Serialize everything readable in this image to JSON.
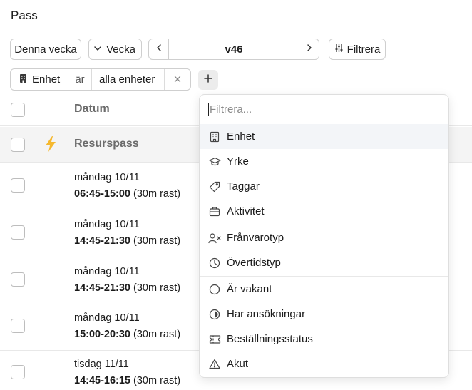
{
  "page": {
    "title": "Pass"
  },
  "toolbar": {
    "current_week_label": "Denna vecka",
    "week_select_label": "Vecka",
    "week_value": "v46",
    "filter_label": "Filtrera"
  },
  "active_filter": {
    "field": "Enhet",
    "operator": "är",
    "value": "alla enheter"
  },
  "table": {
    "date_header": "Datum",
    "resource_label": "Resurspass",
    "shifts": [
      {
        "day": "måndag 10/11",
        "time": "06:45-15:00",
        "break": " (30m rast)"
      },
      {
        "day": "måndag 10/11",
        "time": "14:45-21:30",
        "break": " (30m rast)"
      },
      {
        "day": "måndag 10/11",
        "time": "14:45-21:30",
        "break": " (30m rast)"
      },
      {
        "day": "måndag 10/11",
        "time": "15:00-20:30",
        "break": " (30m rast)"
      },
      {
        "day": "tisdag 11/11",
        "time": "14:45-16:15",
        "break": " (30m rast)"
      }
    ]
  },
  "dropdown": {
    "search_placeholder": "Filtrera...",
    "items": [
      {
        "label": "Enhet",
        "icon": "building-icon"
      },
      {
        "label": "Yrke",
        "icon": "graduation-cap-icon"
      },
      {
        "label": "Taggar",
        "icon": "tag-icon"
      },
      {
        "label": "Aktivitet",
        "icon": "briefcase-icon"
      },
      {
        "label": "Frånvarotyp",
        "icon": "user-x-icon"
      },
      {
        "label": "Övertidstyp",
        "icon": "clock-icon"
      },
      {
        "label": "Är vakant",
        "icon": "circle-icon"
      },
      {
        "label": "Har ansökningar",
        "icon": "circle-half-icon"
      },
      {
        "label": "Beställningsstatus",
        "icon": "ticket-icon"
      },
      {
        "label": "Akut",
        "icon": "alert-triangle-icon"
      }
    ]
  },
  "colors": {
    "accent_bolt": "#f5b82e",
    "highlight_row": "#f3f5f8"
  }
}
